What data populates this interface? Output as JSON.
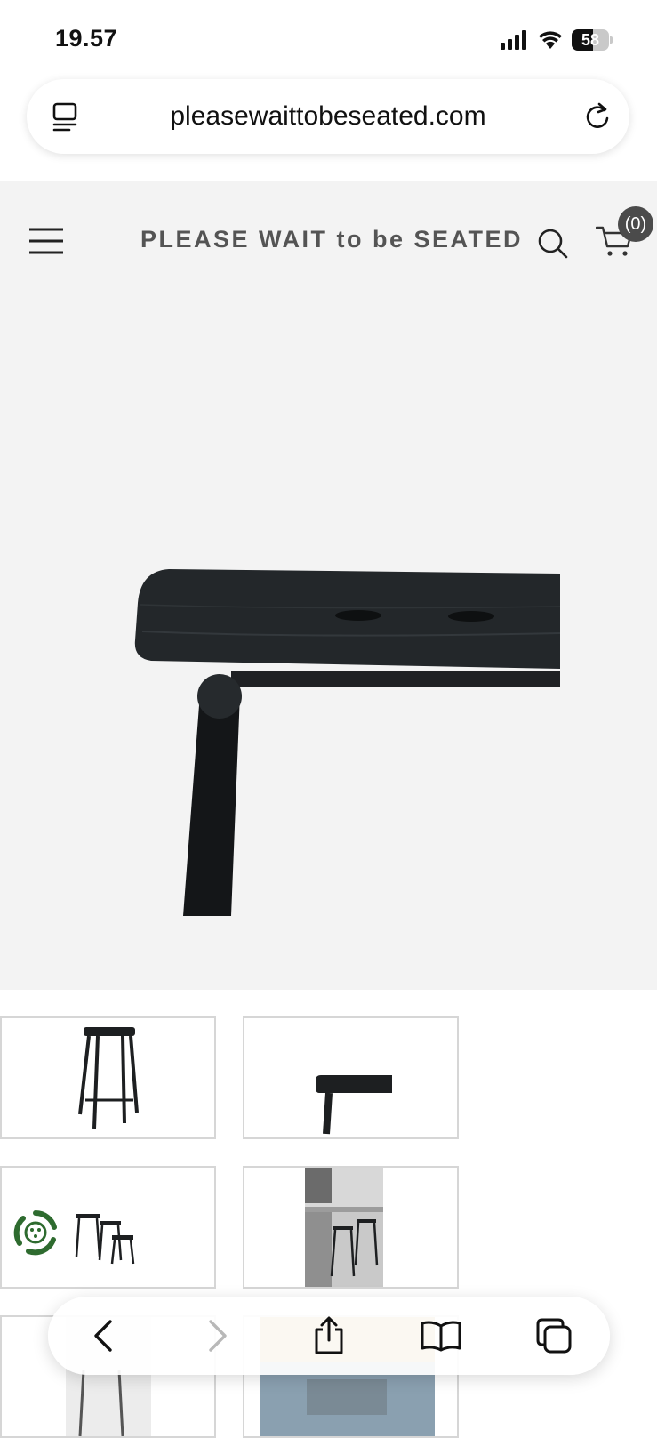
{
  "status_bar": {
    "time": "19.57",
    "battery_percent": "58",
    "battery_level": 0.58,
    "icons": [
      "signal-icon",
      "wifi-icon",
      "battery-icon"
    ]
  },
  "browser": {
    "url": "pleasewaittobeseated.com",
    "icons": [
      "reader-mode-icon",
      "reload-icon"
    ]
  },
  "site_header": {
    "brand": "PLEASE WAIT to be SEATED",
    "cart_count": "(0)",
    "icons": [
      "hamburger-menu-icon",
      "search-icon",
      "cart-icon"
    ]
  },
  "product": {
    "main_image": "black bar stool seat close-up",
    "thumbnails": [
      "bar-stool-full-view",
      "bar-stool-seat-detail",
      "three-stools-group",
      "stools-in-kitchen-photo",
      "stool-partial-view",
      "stool-interior-photo"
    ]
  },
  "floating_badge": {
    "icon": "eco-recycle-icon",
    "color": "#2e6b2f"
  },
  "toolbar": {
    "icons": [
      "back-icon",
      "forward-icon",
      "share-icon",
      "bookmarks-icon",
      "tabs-icon"
    ]
  }
}
